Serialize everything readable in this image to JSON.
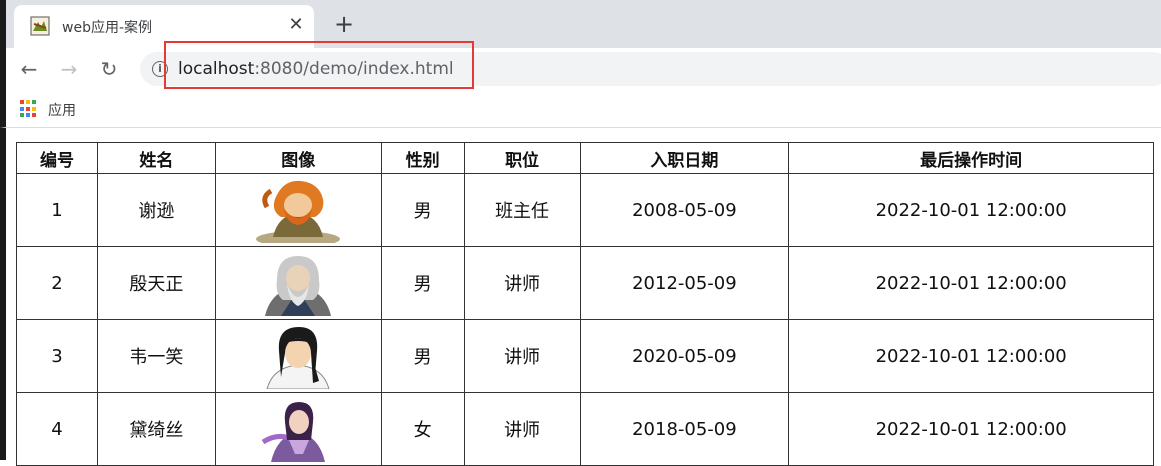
{
  "browser": {
    "tab_title": "web应用-案例",
    "tab_close": "✕",
    "new_tab": "+",
    "back": "←",
    "forward": "→",
    "reload": "↻",
    "url_host": "localhost",
    "url_rest": ":8080/demo/index.html",
    "info": "i",
    "bookmark_apps_label": "应用"
  },
  "table": {
    "headers": [
      "编号",
      "姓名",
      "图像",
      "性别",
      "职位",
      "入职日期",
      "最后操作时间"
    ],
    "rows": [
      {
        "id": "1",
        "name": "谢逊",
        "avatar": "avatar-orange-hair",
        "gender": "男",
        "position": "班主任",
        "hire_date": "2008-05-09",
        "updated": "2022-10-01 12:00:00"
      },
      {
        "id": "2",
        "name": "殷天正",
        "avatar": "avatar-grey-elder",
        "gender": "男",
        "position": "讲师",
        "hire_date": "2012-05-09",
        "updated": "2022-10-01 12:00:00"
      },
      {
        "id": "3",
        "name": "韦一笑",
        "avatar": "avatar-black-hair",
        "gender": "男",
        "position": "讲师",
        "hire_date": "2020-05-09",
        "updated": "2022-10-01 12:00:00"
      },
      {
        "id": "4",
        "name": "黛绮丝",
        "avatar": "avatar-purple-lady",
        "gender": "女",
        "position": "讲师",
        "hire_date": "2018-05-09",
        "updated": "2022-10-01 12:00:00"
      }
    ]
  },
  "colors": {
    "highlight": "#e53935",
    "tabstrip": "#dee1e6",
    "omnibox": "#f1f3f4"
  }
}
